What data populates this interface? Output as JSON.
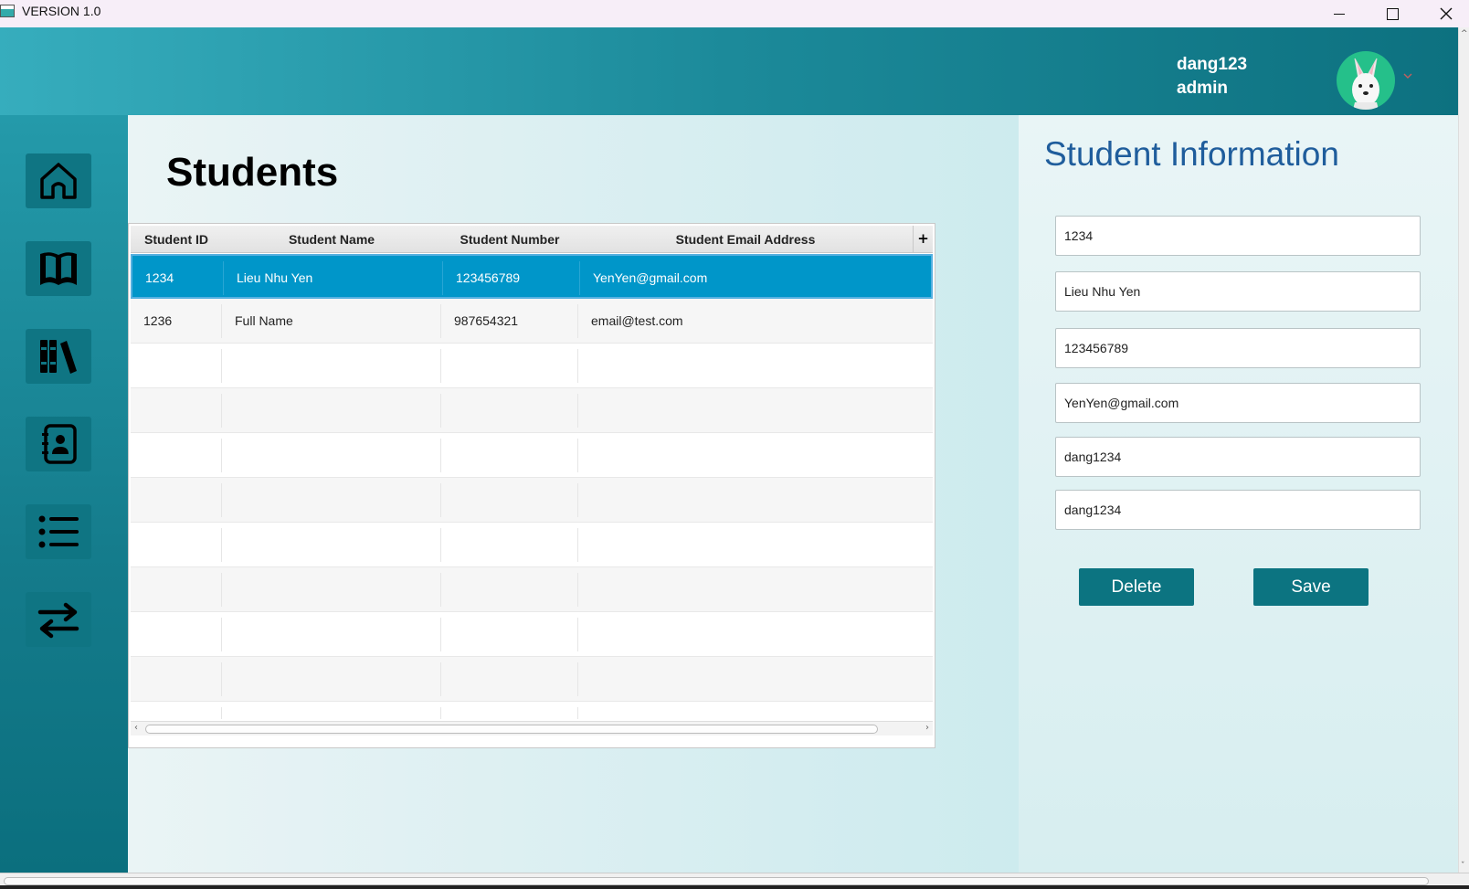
{
  "window": {
    "title": "VERSION 1.0"
  },
  "header": {
    "username": "dang123",
    "role": "admin"
  },
  "sidebar": {
    "items": [
      {
        "icon": "home-icon"
      },
      {
        "icon": "book-icon"
      },
      {
        "icon": "library-icon"
      },
      {
        "icon": "contacts-icon"
      },
      {
        "icon": "list-icon"
      },
      {
        "icon": "transfer-icon"
      }
    ]
  },
  "page": {
    "title": "Students"
  },
  "table": {
    "columns": [
      "Student ID",
      "Student Name",
      "Student Number",
      "Student Email Address"
    ],
    "add_column_label": "+",
    "rows": [
      {
        "id": "1234",
        "name": "Lieu Nhu Yen",
        "number": "123456789",
        "email": "YenYen@gmail.com",
        "selected": true
      },
      {
        "id": "1236",
        "name": "Full Name",
        "number": "987654321",
        "email": "email@test.com",
        "selected": false
      }
    ]
  },
  "info": {
    "title": "Student Information",
    "fields": [
      {
        "name": "student-id-field",
        "value": "1234"
      },
      {
        "name": "student-name-field",
        "value": "Lieu Nhu Yen"
      },
      {
        "name": "student-number-field",
        "value": "123456789"
      },
      {
        "name": "student-email-field",
        "value": "YenYen@gmail.com"
      },
      {
        "name": "username-field",
        "value": "dang1234"
      },
      {
        "name": "password-field",
        "value": "dang1234"
      }
    ],
    "delete_label": "Delete",
    "save_label": "Save"
  },
  "colors": {
    "accent": "#0c7481",
    "selection": "#0096c9",
    "title_blue": "#1f5d9c"
  }
}
